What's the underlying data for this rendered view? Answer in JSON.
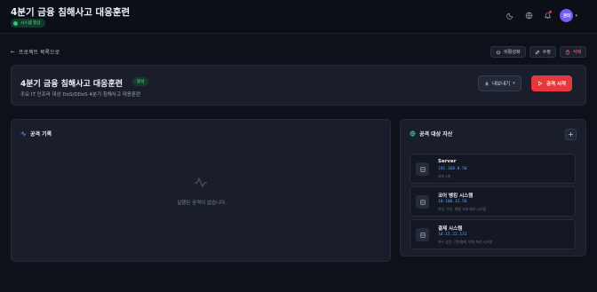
{
  "header": {
    "title": "4분기 금융 침해사고 대응훈련",
    "system_badge": "시스템 정상",
    "avatar_initials": "관리"
  },
  "nav": {
    "back_label": "프로젝트 목록으로"
  },
  "actions": {
    "deactivate_label": "비활성화",
    "edit_label": "수정",
    "delete_label": "삭제"
  },
  "project": {
    "title": "4분기 금융 침해사고 대응훈련",
    "status": "활성",
    "description": "주요 IT 인프라 대상 DoS/DDoS 4분기 침해사고 대응훈련",
    "export_label": "내보내기",
    "start_label": "공격 시작"
  },
  "attack_log": {
    "title": "공격 기록",
    "empty_text": "실행된 공격이 없습니다."
  },
  "assets": {
    "title": "공격 대상 자산",
    "add_label": "+",
    "items": [
      {
        "name": "Server",
        "ip": "192.168.0.50",
        "note": "서버 1대"
      },
      {
        "name": "코어 뱅킹 시스템",
        "ip": "10.100.12.50",
        "note": "여신, 수신, 외환 거래 처리 시스템"
      },
      {
        "name": "결제 시스템",
        "ip": "10.15.22.131",
        "note": "카드 승인, 간편결제, 이체 처리 시스템"
      }
    ]
  },
  "colors": {
    "accent_red": "#e5383b",
    "status_green": "#4ddc8e",
    "ip_blue": "#5aa0ff",
    "avatar_purple": "#7b5cf0"
  }
}
